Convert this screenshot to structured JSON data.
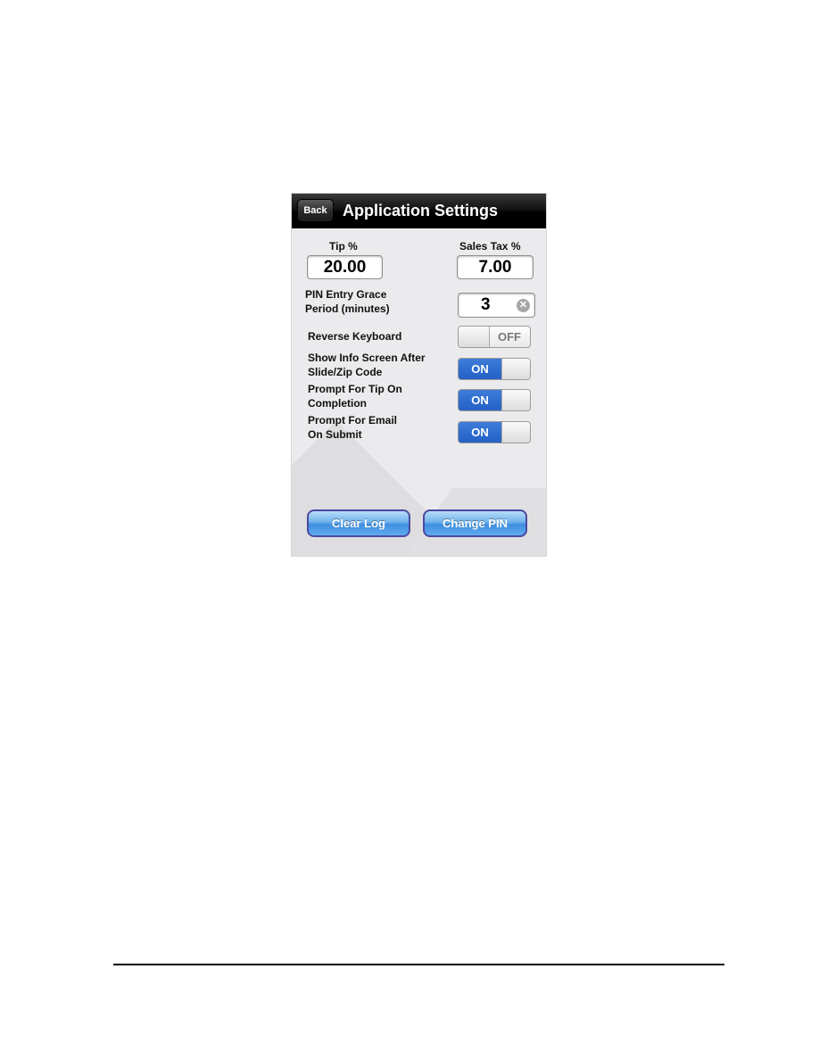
{
  "navbar": {
    "back_label": "Back",
    "title": "Application Settings"
  },
  "tip": {
    "label": "Tip %",
    "value": "20.00"
  },
  "sales_tax": {
    "label": "Sales Tax %",
    "value": "7.00"
  },
  "pin_grace": {
    "label_line1": "PIN Entry Grace",
    "label_line2": "Period (minutes)",
    "value": "3"
  },
  "toggles": [
    {
      "label_line1": "Reverse Keyboard",
      "label_line2": "",
      "state": "OFF"
    },
    {
      "label_line1": "Show Info Screen After",
      "label_line2": "Slide/Zip Code",
      "state": "ON"
    },
    {
      "label_line1": "Prompt For Tip On",
      "label_line2": "Completion",
      "state": "ON"
    },
    {
      "label_line1": "Prompt For Email",
      "label_line2": "On Submit",
      "state": "ON"
    }
  ],
  "buttons": {
    "clear_log": "Clear Log",
    "change_pin": "Change PIN"
  },
  "colors": {
    "toggle_on": "#2f6dd0",
    "button_blue": "#62aaf0",
    "navbar": "#000000"
  }
}
